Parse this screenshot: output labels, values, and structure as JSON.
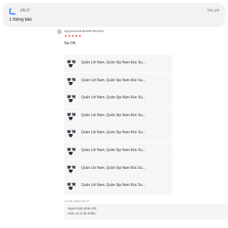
{
  "notification": {
    "app_name": "ZALO",
    "time": "bây giờ",
    "text": "1 thông báo"
  },
  "review": {
    "username": "nguyenvantuan0987654321",
    "stars": "★★★★★",
    "rating": 5,
    "text": "Sp OK."
  },
  "products": [
    {
      "name": "Quần Lót Nam, Quần Sịp Nam Đúc Su..."
    },
    {
      "name": "Quần Lót Nam, Quần Sịp Nam Đúc Su..."
    },
    {
      "name": "Quần Lót Nam, Quần Sịp Nam Đúc Su..."
    },
    {
      "name": "Quần Lót Nam, Quần Sịp Nam Đúc Su..."
    },
    {
      "name": "Quần Lót Nam, Quần Sịp Nam Đúc Su..."
    },
    {
      "name": "Quần Lót Nam, Quần Sịp Nam Đúc Su..."
    },
    {
      "name": "Quần Lót Nam, Quần Sịp Nam Đúc Su..."
    },
    {
      "name": "Quần Lót Nam, Quần Sịp Nam Đúc Su..."
    }
  ],
  "timestamp": "14-05-2020 09:47",
  "seller": {
    "label": "Người bán phản hồi:",
    "reply": "Cảm ơn b rất nhiều."
  },
  "colors": {
    "star": "#ee4d2d",
    "zalo_blue": "#0068ff"
  }
}
